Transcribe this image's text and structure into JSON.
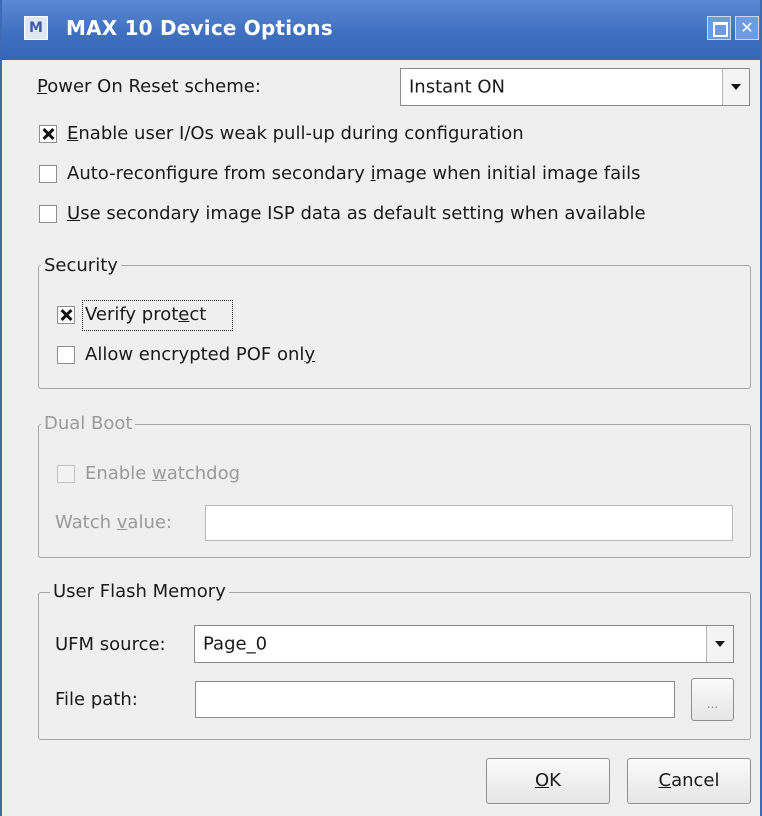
{
  "window": {
    "title": "MAX 10 Device Options",
    "app_icon_glyph": "M",
    "close_glyph": "✕"
  },
  "power_on_reset": {
    "label": "Power On Reset scheme:",
    "label_mnemonic": "P",
    "label_rest": "ower On Reset scheme:",
    "selected": "Instant ON"
  },
  "options": [
    {
      "label_pre": "",
      "mnemonic": "E",
      "label_post": "nable user I/Os weak pull-up during configuration",
      "checked": true
    },
    {
      "label_pre": "Auto-reconfigure from secondary ",
      "mnemonic": "i",
      "label_post": "mage when initial image fails",
      "checked": false
    },
    {
      "label_pre": "",
      "mnemonic": "U",
      "label_post": "se secondary image ISP data as default setting when available",
      "checked": false
    }
  ],
  "security": {
    "title": "Security",
    "verify_protect": {
      "label_pre": "Verify prot",
      "mnemonic": "e",
      "label_post": "ct",
      "checked": true
    },
    "allow_encrypted": {
      "label_pre": "Allow encrypted POF onl",
      "mnemonic": "y",
      "label_post": "",
      "checked": false
    }
  },
  "dual_boot": {
    "title": "Dual Boot",
    "enable_watchdog": {
      "label_pre": "Enable ",
      "mnemonic": "w",
      "label_post": "atchdog",
      "checked": false
    },
    "watch_value": {
      "label_pre": "Watch ",
      "mnemonic": "v",
      "label_post": "alue:",
      "value": ""
    }
  },
  "user_flash_memory": {
    "title": "User Flash Memory",
    "ufm_source_label": "UFM source:",
    "ufm_source_selected": "Page_0",
    "file_path_label": "File path:",
    "file_path_value": "",
    "browse_label": "..."
  },
  "buttons": {
    "ok_mnemonic": "O",
    "ok_rest": "K",
    "cancel_mnemonic": "C",
    "cancel_rest": "ancel"
  }
}
